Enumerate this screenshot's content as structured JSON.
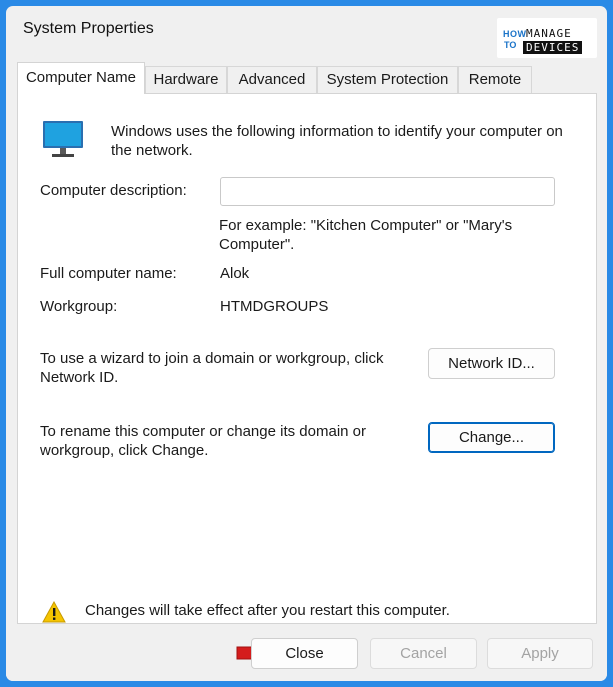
{
  "window": {
    "title": "System Properties"
  },
  "logo": {
    "how": "HOW",
    "to": "TO",
    "manage": "MANAGE",
    "devices": "DEVICES"
  },
  "tabs": [
    {
      "label": "Computer Name",
      "active": true
    },
    {
      "label": "Hardware",
      "active": false
    },
    {
      "label": "Advanced",
      "active": false
    },
    {
      "label": "System Protection",
      "active": false
    },
    {
      "label": "Remote",
      "active": false
    }
  ],
  "panel": {
    "intro": "Windows uses the following information to identify your computer on the network.",
    "description_label": "Computer description:",
    "description_value": "",
    "description_placeholder": "",
    "example": "For example: \"Kitchen Computer\" or \"Mary's Computer\".",
    "full_name_label": "Full computer name:",
    "full_name_value": "Alok",
    "workgroup_label": "Workgroup:",
    "workgroup_value": "HTMDGROUPS",
    "network_id_text": "To use a wizard to join a domain or workgroup, click Network ID.",
    "network_id_button": "Network ID...",
    "rename_text": "To rename this computer or change its domain or workgroup, click Change.",
    "change_button": "Change...",
    "warning": "Changes will take effect after you restart this computer."
  },
  "footer": {
    "close": "Close",
    "cancel": "Cancel",
    "apply": "Apply"
  },
  "colors": {
    "accent": "#0067c0",
    "background": "#2a8ae6",
    "arrow": "#d41c1c",
    "warning": "#f5c400"
  }
}
